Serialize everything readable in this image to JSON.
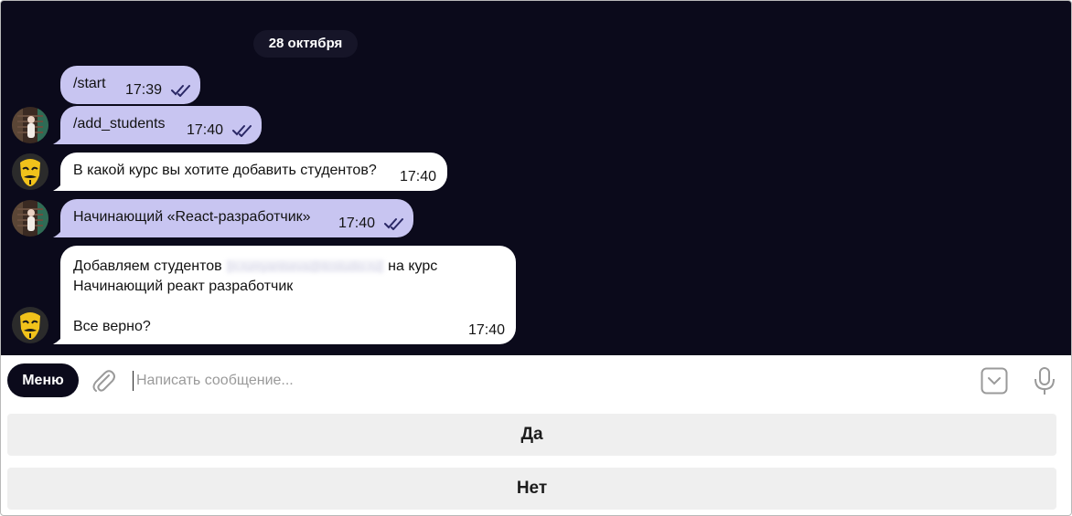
{
  "chat": {
    "date_label": "28 октября",
    "messages": [
      {
        "direction": "out",
        "text": "/start",
        "time": "17:39",
        "status": "read"
      },
      {
        "direction": "out",
        "text": "/add_students",
        "time": "17:40",
        "status": "read"
      },
      {
        "direction": "in",
        "text": "В какой курс вы хотите добавить студентов?",
        "time": "17:40"
      },
      {
        "direction": "out",
        "text": "Начинающий «React-разработчик»",
        "time": "17:40",
        "status": "read"
      },
      {
        "direction": "in",
        "text_line1_prefix": "Добавляем студентов",
        "text_line1_redacted": "[n.rumyantseva@itcstudio.ru]",
        "text_line1_suffix": "на курс",
        "text_line2": "Начинающий реакт разработчик",
        "text_line4": "Все верно?",
        "time": "17:40"
      }
    ]
  },
  "composer": {
    "menu_label": "Меню",
    "placeholder": "Написать сообщение..."
  },
  "reply_keyboard": {
    "buttons": [
      "Да",
      "Нет"
    ]
  },
  "icons": {
    "attach": "paperclip-icon",
    "keyboard_toggle": "keyboard-toggle-icon",
    "mic": "microphone-icon",
    "read_status": "double-check-icon"
  },
  "colors": {
    "chat_background": "#0b0a1b",
    "outgoing_bubble": "#c8c5f1",
    "incoming_bubble": "#ffffff",
    "reply_button": "#efefef"
  }
}
